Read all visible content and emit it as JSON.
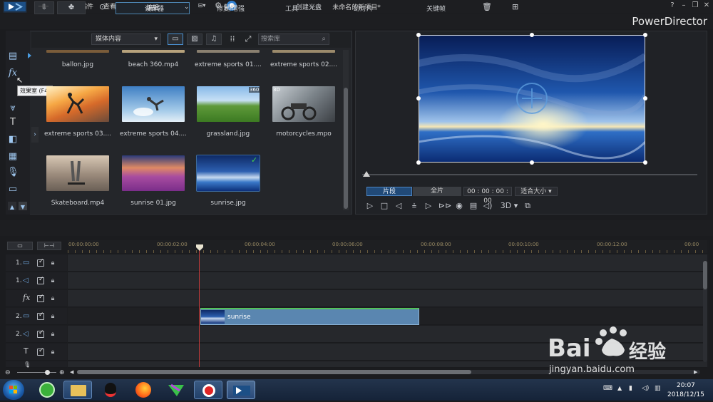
{
  "menu": [
    "文件",
    "编辑",
    "插件",
    "查看",
    "播放"
  ],
  "title": "未命名的新项目*",
  "brand": "PowerDirector",
  "modes": [
    "捕捉",
    "编辑",
    "制作",
    "创建光盘"
  ],
  "library": {
    "content_select": "媒体内容",
    "search_placeholder": "搜索库",
    "tooltip": "效果室 (F4)",
    "items": [
      {
        "label": "ballon.jpg"
      },
      {
        "label": "beach 360.mp4"
      },
      {
        "label": "extreme sports 01...."
      },
      {
        "label": "extreme sports 02...."
      },
      {
        "label": "extreme sports 03...."
      },
      {
        "label": "extreme sports 04...."
      },
      {
        "label": "grassland.jpg",
        "badge": "360"
      },
      {
        "label": "motorcycles.mpo",
        "badge": "3D"
      },
      {
        "label": "Skateboard.mp4"
      },
      {
        "label": "sunrise 01.jpg"
      },
      {
        "label": "sunrise.jpg",
        "checked": true
      }
    ]
  },
  "preview": {
    "seg_clip": "片段",
    "seg_movie": "全片",
    "timecode": "00 : 00 : 00 : 00",
    "fit": "适合大小",
    "mode3d": "3D"
  },
  "toolbar": [
    "设计器",
    "修复/增强",
    "工具",
    "幻灯片",
    "关键帧"
  ],
  "ruler": [
    "00:00:00:00",
    "00:00:02:00",
    "00:00:04:00",
    "00:00:06:00",
    "00:00:08:00",
    "00:00:10:00",
    "00:00:12:00",
    "00:00"
  ],
  "tracks": [
    {
      "num": "1.",
      "kind": "video"
    },
    {
      "num": "1.",
      "kind": "audio"
    },
    {
      "num": "",
      "kind": "fx"
    },
    {
      "num": "2.",
      "kind": "video"
    },
    {
      "num": "2.",
      "kind": "audio"
    },
    {
      "num": "",
      "kind": "title"
    },
    {
      "num": "",
      "kind": "voice"
    }
  ],
  "clip": {
    "label": "sunrise"
  },
  "taskbar": {
    "time": "20:07",
    "date": "2018/12/15"
  },
  "watermark": {
    "line1": "Bai",
    "line2": "经验",
    "url": "jingyan.baidu.com"
  }
}
